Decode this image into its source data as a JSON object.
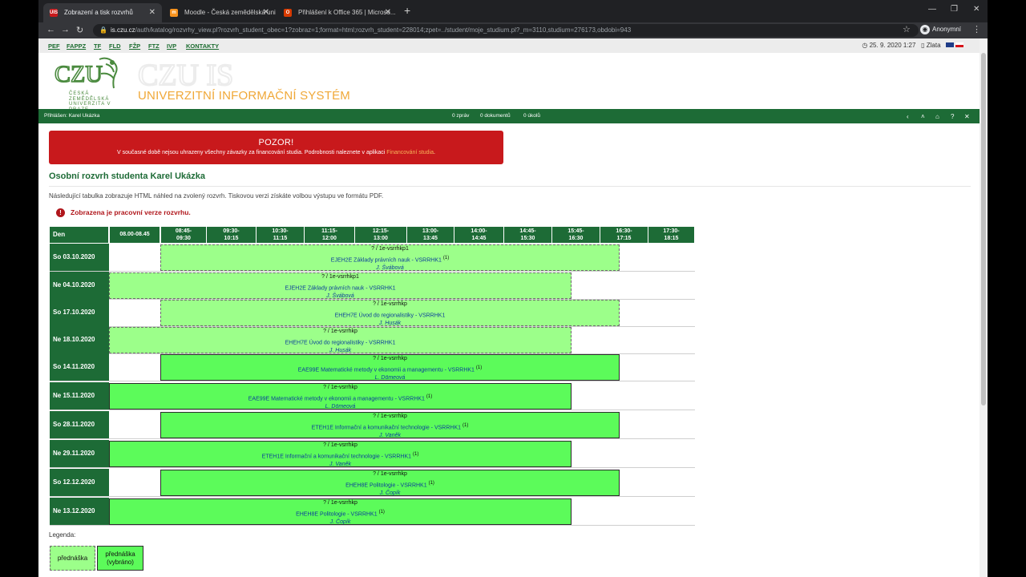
{
  "browser": {
    "tabs": [
      {
        "label": "Zobrazení a tisk rozvrhů",
        "favicon": "UIS"
      },
      {
        "label": "Moodle - Česká zemědělská uni...",
        "favicon": "m"
      },
      {
        "label": "Přihlášení k Office 365 | Microso...",
        "favicon": "O"
      }
    ],
    "url_host": "is.czu.cz",
    "url_path": "/auth/katalog/rozvrhy_view.pl?rozvrh_student_obec=1?zobraz=1;format=html;rozvrh_student=228014;zpet=../student/moje_studium.pl?_m=3110,studium=276173,obdobi=943",
    "profile": "Anonymní"
  },
  "topbar": {
    "faculties": [
      "PEF",
      "FAPPZ",
      "TF",
      "FLD",
      "FŽP",
      "FTZ",
      "IVP",
      "KONTAKTY"
    ],
    "datetime": "25. 9. 2020  1:27",
    "nameday": "Zlata"
  },
  "header": {
    "logo_text_1": "ČESKÁ",
    "logo_text_2": "ZEMĚDĚLSKÁ",
    "logo_text_3": "UNIVERZITA V PRAZE",
    "title": "UNIVERZITNÍ INFORMAČNÍ SYSTÉM"
  },
  "greenbar": {
    "user": "Přihlášen: Karel Ukázka",
    "messages": "0 zpráv",
    "documents": "0 dokumentů",
    "tasks": "0 úkolů"
  },
  "alert": {
    "title": "POZOR!",
    "text": "V současné době nejsou uhrazeny všechny závazky za financování studia. Podrobnosti naleznete v aplikaci",
    "link": "Financování studia",
    "suffix": "."
  },
  "main": {
    "heading": "Osobní rozvrh studenta Karel Ukázka",
    "description": "Následující tabulka zobrazuje HTML náhled na zvolený rozvrh. Tiskovou verzi získáte volbou výstupu ve formátu PDF.",
    "warning": "Zobrazena je pracovní verze rozvrhu."
  },
  "schedule": {
    "header_day": "Den",
    "slots": [
      {
        "a": "08.00-08.45",
        "b": ""
      },
      {
        "a": "08:45-",
        "b": "09:30"
      },
      {
        "a": "09:30-",
        "b": "10:15"
      },
      {
        "a": "10:30-",
        "b": "11:15"
      },
      {
        "a": "11:15-",
        "b": "12:00"
      },
      {
        "a": "12:15-",
        "b": "13:00"
      },
      {
        "a": "13:00-",
        "b": "13:45"
      },
      {
        "a": "14:00-",
        "b": "14:45"
      },
      {
        "a": "14:45-",
        "b": "15:30"
      },
      {
        "a": "15:45-",
        "b": "16:30"
      },
      {
        "a": "16:30-",
        "b": "17:15"
      },
      {
        "a": "17:30-",
        "b": "18:15"
      }
    ],
    "rows": [
      {
        "day": "So 03.10.2020",
        "style": "light",
        "start": 1,
        "end": 10,
        "room": "?  /  1e-vsrrhkp1",
        "course": "EJEH2E Základy právních nauk - VSRRHK1",
        "note": "(1)",
        "teacher": "J. Švábová"
      },
      {
        "day": "Ne 04.10.2020",
        "style": "light",
        "start": 0,
        "end": 9,
        "room": "?  /  1e-vsrrhkp1",
        "course": "EJEH2E Základy právních nauk - VSRRHK1",
        "note": "",
        "teacher": "J. Švábová"
      },
      {
        "day": "So 17.10.2020",
        "style": "light",
        "start": 1,
        "end": 10,
        "room": "?  /  1e-vsrrhkp",
        "course": "EHEH7E Úvod do regionalistiky - VSRRHK1",
        "note": "",
        "teacher": "J. Husák"
      },
      {
        "day": "Ne 18.10.2020",
        "style": "light",
        "start": 0,
        "end": 9,
        "room": "?  /  1e-vsrrhkp",
        "course": "EHEH7E Úvod do regionalistiky - VSRRHK1",
        "note": "",
        "teacher": "J. Husák"
      },
      {
        "day": "So 14.11.2020",
        "style": "dark",
        "start": 1,
        "end": 10,
        "room": "?  /  1e-vsrrhkp",
        "course": "EAE99E Matematické metody v ekonomii a managementu - VSRRHK1",
        "note": "(1)",
        "teacher": "L. Dömeová"
      },
      {
        "day": "Ne 15.11.2020",
        "style": "dark",
        "start": 0,
        "end": 9,
        "room": "?  /  1e-vsrrhkp",
        "course": "EAE99E Matematické metody v ekonomii a managementu - VSRRHK1",
        "note": "(1)",
        "teacher": "L. Dömeová"
      },
      {
        "day": "So 28.11.2020",
        "style": "dark",
        "start": 1,
        "end": 10,
        "room": "?  /  1e-vsrrhkp",
        "course": "ETEH1E Informační a komunikační technologie - VSRRHK1",
        "note": "(1)",
        "teacher": "J. Vaněk"
      },
      {
        "day": "Ne 29.11.2020",
        "style": "dark",
        "start": 0,
        "end": 9,
        "room": "?  /  1e-vsrrhkp",
        "course": "ETEH1E Informační a komunikační technologie - VSRRHK1",
        "note": "(1)",
        "teacher": "J. Vaněk"
      },
      {
        "day": "So 12.12.2020",
        "style": "dark",
        "start": 1,
        "end": 10,
        "room": "?  /  1e-vsrrhkp",
        "course": "EHEH8E Politologie - VSRRHK1",
        "note": "(1)",
        "teacher": "J. Čopík"
      },
      {
        "day": "Ne 13.12.2020",
        "style": "dark",
        "start": 0,
        "end": 9,
        "room": "?  /  1e-vsrrhkp",
        "course": "EHEH8E Politologie - VSRRHK1",
        "note": "(1)",
        "teacher": "J. Čopík"
      }
    ]
  },
  "legend": {
    "title": "Legenda:",
    "item1": "přednáška",
    "item2a": "přednáška",
    "item2b": "(vybráno)"
  },
  "colors": {
    "brand_green": "#1d6b36",
    "alert_red": "#c8191c",
    "event_light": "#9cff8a",
    "event_dark": "#5cfb5a"
  }
}
